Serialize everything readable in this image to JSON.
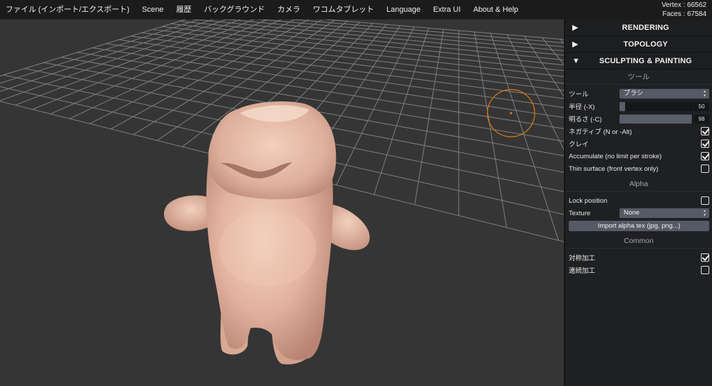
{
  "menu": [
    {
      "label": "ファイル (インポート/エクスポート)"
    },
    {
      "label": "Scene"
    },
    {
      "label": "履歴"
    },
    {
      "label": "バックグラウンド"
    },
    {
      "label": "カメラ"
    },
    {
      "label": "ワコムタブレット"
    },
    {
      "label": "Language"
    },
    {
      "label": "Extra UI"
    },
    {
      "label": "About & Help"
    }
  ],
  "stats": {
    "vertex": "Vertex : 66562",
    "faces": "Faces : 67584"
  },
  "panel": {
    "sections": {
      "rendering": {
        "arrow": "▶",
        "title": "RENDERING"
      },
      "topology": {
        "arrow": "▶",
        "title": "TOPOLOGY"
      },
      "sculpting": {
        "arrow": "▼",
        "title": "SCULPTING & PAINTING"
      }
    },
    "tool_header": "ツール",
    "tool_label": "ツール",
    "tool_value": "ブラシ",
    "radius_label": "半径 (-X)",
    "radius_value": "50",
    "radius_fraction": 0.08,
    "intensity_label": "明るさ (-C)",
    "intensity_value": "98",
    "intensity_fraction": 0.98,
    "negative_label": "ネガティブ (N or -Alt)",
    "negative_checked": true,
    "clay_label": "クレイ",
    "clay_checked": true,
    "accumulate_label": "Accumulate (no limit per stroke)",
    "accumulate_checked": true,
    "thin_label": "Thin surface (front vertex only)",
    "thin_checked": false,
    "alpha_header": "Alpha",
    "lock_label": "Lock position",
    "lock_checked": false,
    "texture_label": "Texture",
    "texture_value": "None",
    "import_label": "Import alpha tex (jpg, png...)",
    "common_header": "Common",
    "symmetry_label": "対称加工",
    "symmetry_checked": true,
    "continuous_label": "連続加工",
    "continuous_checked": false
  },
  "colors": {
    "background": "#353535",
    "grid": "#9a9a9a",
    "mesh": "#e8c0ac",
    "brush_cursor": "#e07b10"
  }
}
